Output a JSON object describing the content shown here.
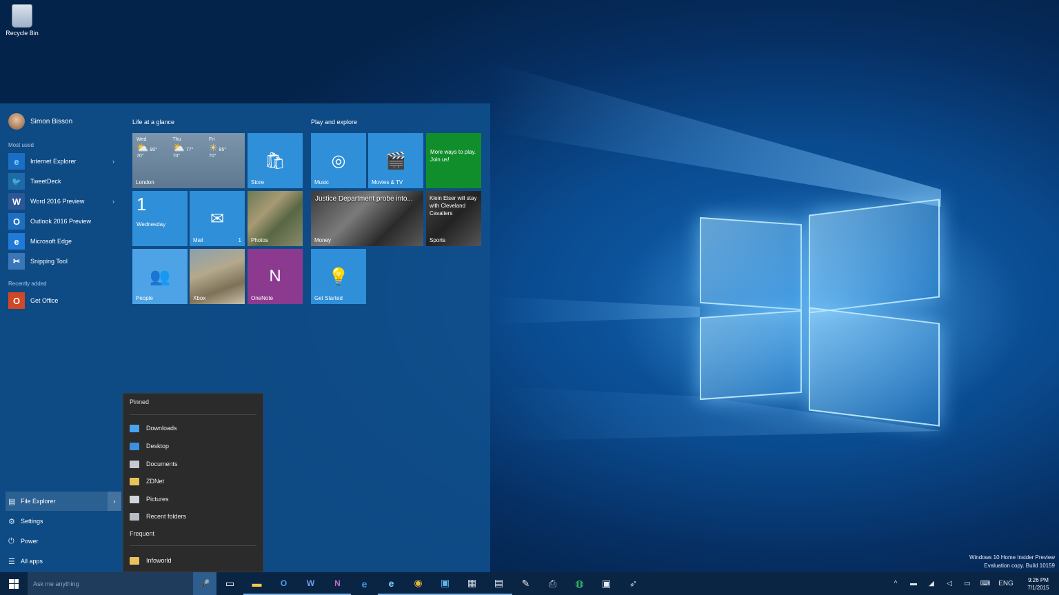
{
  "desktop": {
    "recycle_bin_label": "Recycle Bin",
    "watermark_line1": "Windows 10 Home Insider Preview",
    "watermark_line2": "Evaluation copy. Build 10159"
  },
  "start_menu": {
    "user_name": "Simon Bisson",
    "most_used_label": "Most used",
    "recently_added_label": "Recently added",
    "most_used": [
      {
        "label": "Internet Explorer",
        "icon": "internet-explorer-icon",
        "has_arrow": true
      },
      {
        "label": "TweetDeck",
        "icon": "twitter-icon",
        "has_arrow": false
      },
      {
        "label": "Word 2016 Preview",
        "icon": "word-icon",
        "has_arrow": true
      },
      {
        "label": "Outlook 2016 Preview",
        "icon": "outlook-icon",
        "has_arrow": false
      },
      {
        "label": "Microsoft Edge",
        "icon": "edge-icon",
        "has_arrow": false
      },
      {
        "label": "Snipping Tool",
        "icon": "scissors-icon",
        "has_arrow": false
      }
    ],
    "recently_added": [
      {
        "label": "Get Office",
        "icon": "office-icon"
      }
    ],
    "bottom": {
      "file_explorer": "File Explorer",
      "settings": "Settings",
      "power": "Power",
      "all_apps": "All apps"
    },
    "groups": {
      "life": "Life at a glance",
      "play": "Play and explore"
    },
    "tiles": {
      "weather": {
        "days": [
          {
            "day": "Wed",
            "hi": "90°",
            "lo": "70°"
          },
          {
            "day": "Thu",
            "hi": "77°",
            "lo": "70°"
          },
          {
            "day": "Fri",
            "hi": "85°",
            "lo": "70°"
          }
        ],
        "city": "London"
      },
      "store": "Store",
      "calendar": {
        "number": "1",
        "day": "Wednesday"
      },
      "mail": {
        "label": "Mail",
        "count": "1"
      },
      "photos": "Photos",
      "people": "People",
      "xbox": "Xbox",
      "onenote": "OneNote",
      "music": "Music",
      "movies": "Movies & TV",
      "more_ways": "More ways to play. Join us!",
      "money_headline": "Justice Department probe into...",
      "money_label": "Money",
      "sports_headline": "Klein Elser will stay with Cleveland Cavaliers",
      "sports_label": "Sports",
      "get_started": "Get Started"
    }
  },
  "jump_list": {
    "pinned_label": "Pinned",
    "pinned": [
      {
        "label": "Downloads",
        "color": "#4aa3f0"
      },
      {
        "label": "Desktop",
        "color": "#3d8fe0"
      },
      {
        "label": "Documents",
        "color": "#c8c8d0"
      },
      {
        "label": "ZDNet",
        "color": "#e8c45a"
      },
      {
        "label": "Pictures",
        "color": "#d0d4dc"
      },
      {
        "label": "Recent folders",
        "color": "#b8bcc4"
      }
    ],
    "frequent_label": "Frequent",
    "frequent": [
      {
        "label": "Infoworld",
        "color": "#e8c45a"
      }
    ]
  },
  "taskbar": {
    "search_placeholder": "Ask me anything",
    "icons": [
      "task-view-icon",
      "file-explorer-icon",
      "outlook-icon",
      "word-icon",
      "onenote-icon",
      "edge-icon",
      "internet-explorer-icon",
      "chrome-icon",
      "twitter-icon",
      "photos-icon",
      "notepad-icon",
      "paint-icon",
      "printer-icon",
      "spotify-icon",
      "store-icon",
      "bird-icon"
    ],
    "language": "ENG",
    "time": "9:26 PM",
    "date": "7/1/2015"
  }
}
